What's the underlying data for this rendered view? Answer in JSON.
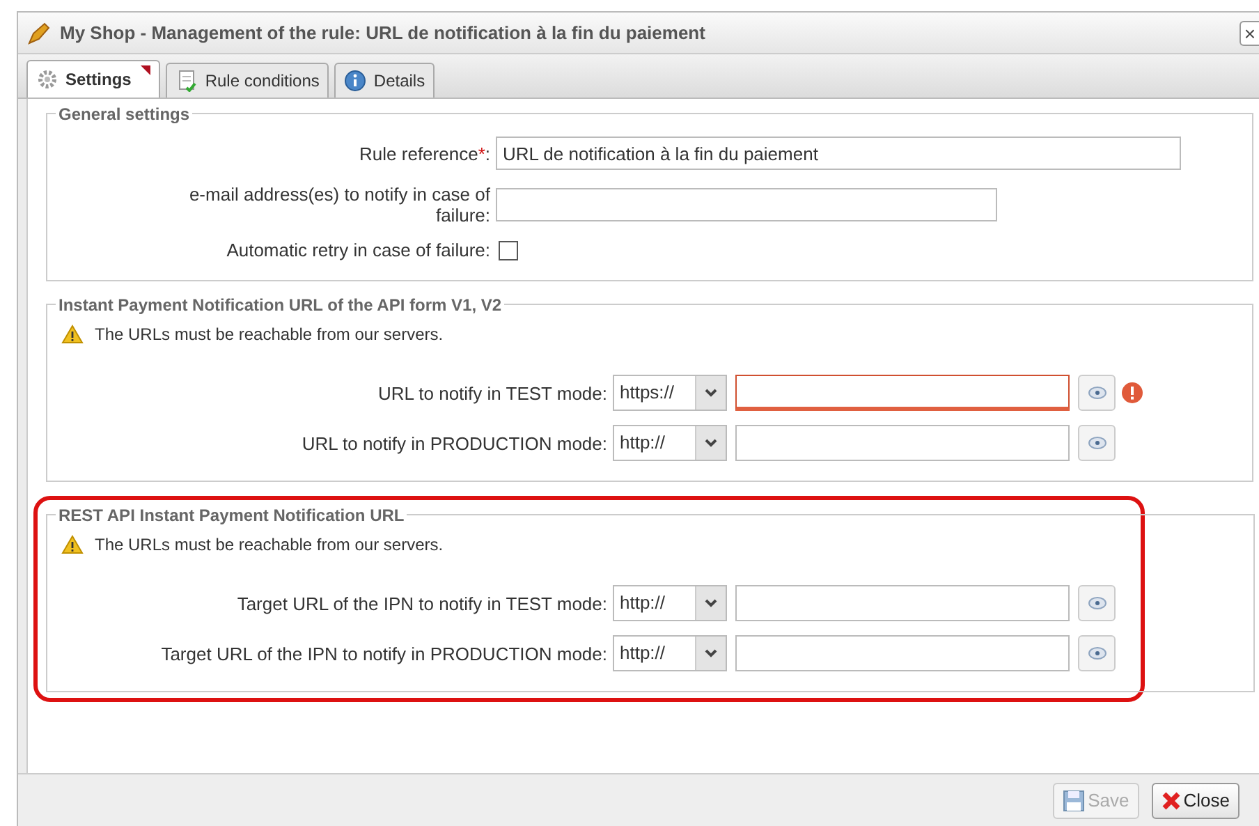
{
  "window": {
    "title": "My Shop - Management of the rule: URL de notification à la fin du paiement",
    "close": "×"
  },
  "tabs": [
    {
      "label": "Settings",
      "selected": true,
      "modified": true
    },
    {
      "label": "Rule conditions",
      "selected": false,
      "modified": false
    },
    {
      "label": "Details",
      "selected": false,
      "modified": false
    }
  ],
  "sections": [
    {
      "legend": "General settings",
      "fields": [
        {
          "kind": "text",
          "label": "Rule reference",
          "required_mark": "*",
          "label_end": ":",
          "value": "URL de notification à la fin du paiement",
          "wide": true
        },
        {
          "kind": "text",
          "label": "e-mail address(es) to notify in case of failure:",
          "wide": false
        },
        {
          "kind": "checkbox",
          "label": "Automatic retry in case of failure:",
          "checked": false
        }
      ]
    },
    {
      "legend": "Instant Payment Notification URL of the API form V1, V2",
      "warning": "The URLs must be reachable from our servers.",
      "fields": [
        {
          "kind": "url",
          "label": "URL to notify in TEST mode:",
          "protocol": "https://",
          "invalid": true
        },
        {
          "kind": "url",
          "label": "URL to notify in PRODUCTION mode:",
          "protocol": "http://",
          "invalid": false
        }
      ]
    },
    {
      "legend": "REST API Instant Payment Notification URL",
      "highlighted": true,
      "warning": "The URLs must be reachable from our servers.",
      "fields": [
        {
          "kind": "url",
          "label": "Target URL of the IPN to notify in TEST mode:",
          "protocol": "http://",
          "invalid": false
        },
        {
          "kind": "url",
          "label": "Target URL of the IPN to notify in PRODUCTION mode:",
          "protocol": "http://",
          "invalid": false
        }
      ]
    }
  ],
  "buttons": [
    {
      "kind": "save",
      "label": "Save",
      "disabled": true
    },
    {
      "kind": "close",
      "label": "Close",
      "disabled": false
    }
  ]
}
